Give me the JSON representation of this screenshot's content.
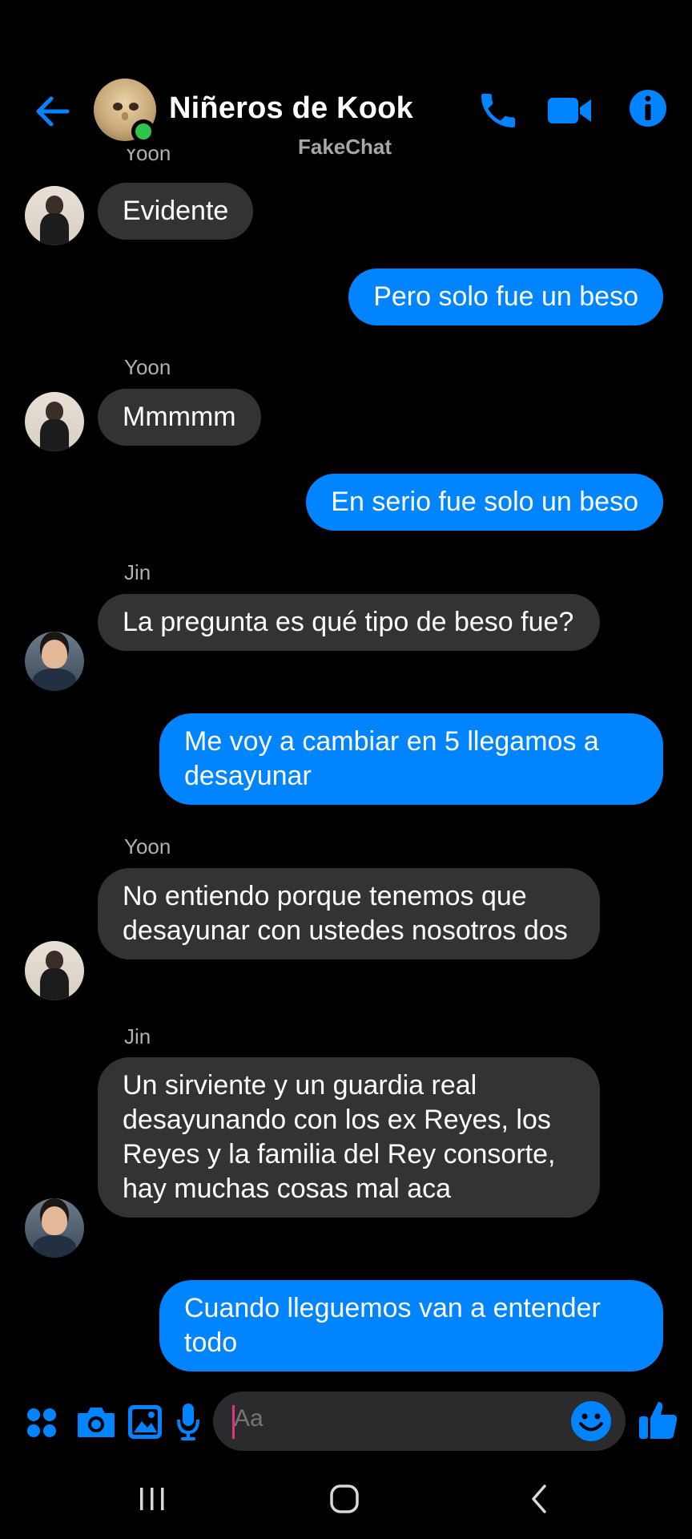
{
  "header": {
    "title": "Niñeros de Kook",
    "subtitle": "FakeChat"
  },
  "colors": {
    "accent": "#0084ff",
    "incoming_bubble": "#333335",
    "online": "#31c24d"
  },
  "messages": [
    {
      "side": "in",
      "sender": "Yoon",
      "text": "Evidente",
      "avatar": "yoon"
    },
    {
      "side": "out",
      "text": "Pero solo fue un beso"
    },
    {
      "side": "in",
      "sender": "Yoon",
      "text": "Mmmmm",
      "avatar": "yoon"
    },
    {
      "side": "out",
      "text": "En serio fue solo un beso"
    },
    {
      "side": "in",
      "sender": "Jin",
      "text": "La pregunta es qué tipo de beso fue?",
      "avatar": "jin"
    },
    {
      "side": "out",
      "text": "Me voy a cambiar en 5 llegamos a desayunar"
    },
    {
      "side": "in",
      "sender": "Yoon",
      "text": "No entiendo porque tenemos que desayunar con ustedes nosotros dos",
      "avatar": "yoon"
    },
    {
      "side": "in",
      "sender": "Jin",
      "text": "Un sirviente y un guardia real desayunando con los ex Reyes, los Reyes y la familia del Rey consorte, hay muchas cosas mal aca",
      "avatar": "jin"
    },
    {
      "side": "out",
      "text": "Cuando lleguemos van a entender todo"
    }
  ],
  "composer": {
    "placeholder": "Aa",
    "icons": [
      "apps-icon",
      "camera-icon",
      "gallery-icon",
      "microphone-icon",
      "emoji-icon",
      "thumbs-up-icon"
    ]
  },
  "navbar": {
    "icons": [
      "recent-apps-icon",
      "home-icon",
      "back-nav-icon"
    ]
  }
}
